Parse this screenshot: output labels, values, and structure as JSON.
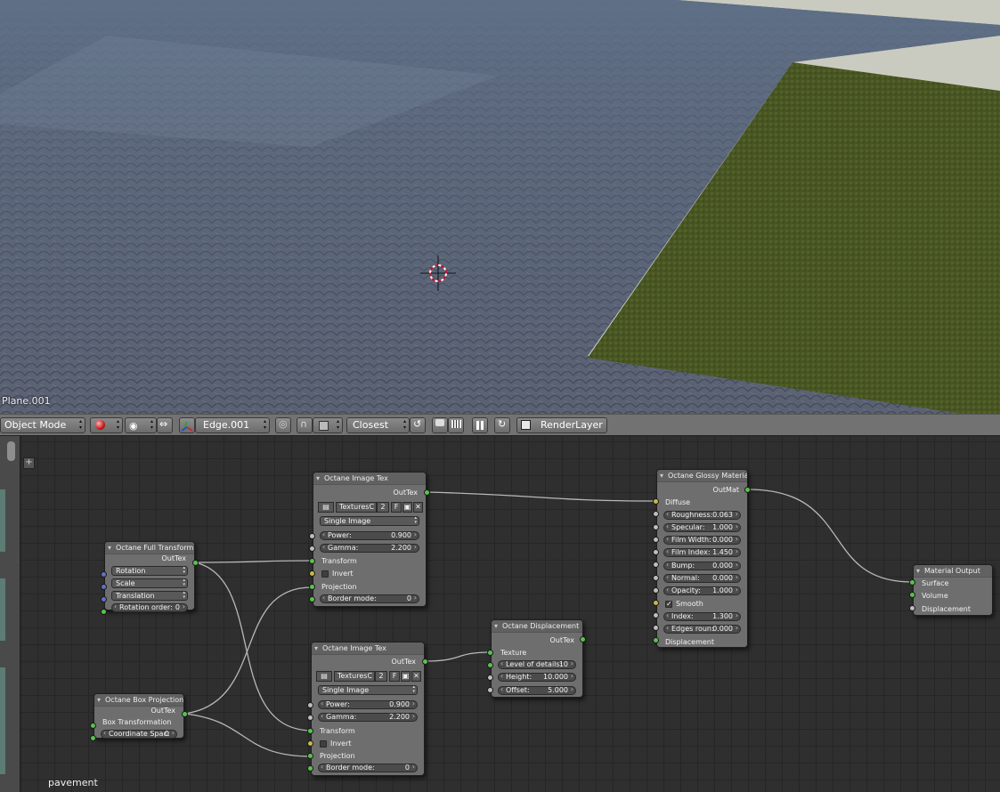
{
  "viewport": {
    "object_label": "Plane.001"
  },
  "header": {
    "mode": "Object Mode",
    "orientation": "Edge.001",
    "snap_element": "Closest",
    "render_layer": "RenderLayer"
  },
  "editor": {
    "material_name": "pavement",
    "add_button": "+"
  },
  "nodes": {
    "full_transform": {
      "title": "Octane Full Transform",
      "output": "OutTex",
      "rotation": "Rotation",
      "scale": "Scale",
      "translation": "Translation",
      "rotation_order_label": "Rotation order:",
      "rotation_order_value": "0"
    },
    "box_projection": {
      "title": "Octane Box Projection",
      "output": "OutTex",
      "box_transformation": "Box Transformation",
      "coordinate_label": "Coordinate Spac:",
      "coordinate_value": "0"
    },
    "image_tex_1": {
      "title": "Octane Image Tex",
      "output": "OutTex",
      "file": "TexturesC",
      "users": "2",
      "fake": "F",
      "mode": "Single Image",
      "power_label": "Power:",
      "power_value": "0.900",
      "gamma_label": "Gamma:",
      "gamma_value": "2.200",
      "transform": "Transform",
      "invert": "Invert",
      "projection": "Projection",
      "border_label": "Border mode:",
      "border_value": "0"
    },
    "image_tex_2": {
      "title": "Octane Image Tex",
      "output": "OutTex",
      "file": "TexturesC",
      "users": "2",
      "fake": "F",
      "mode": "Single Image",
      "power_label": "Power:",
      "power_value": "0.900",
      "gamma_label": "Gamma:",
      "gamma_value": "2.200",
      "transform": "Transform",
      "invert": "Invert",
      "projection": "Projection",
      "border_label": "Border mode:",
      "border_value": "0"
    },
    "displacement": {
      "title": "Octane Displacement",
      "output": "OutTex",
      "texture": "Texture",
      "lod_label": "Level of details:",
      "lod_value": "10",
      "height_label": "Height:",
      "height_value": "10.000",
      "offset_label": "Offset:",
      "offset_value": "5.000"
    },
    "glossy": {
      "title": "Octane Glossy Material",
      "output": "OutMat",
      "diffuse": "Diffuse",
      "roughness_label": "Roughness:",
      "roughness_value": "0.063",
      "specular_label": "Specular:",
      "specular_value": "1.000",
      "film_width_label": "Film Width:",
      "film_width_value": "0.000",
      "film_index_label": "Film Index:",
      "film_index_value": "1.450",
      "bump_label": "Bump:",
      "bump_value": "0.000",
      "normal_label": "Normal:",
      "normal_value": "0.000",
      "opacity_label": "Opacity:",
      "opacity_value": "1.000",
      "smooth": "Smooth",
      "index_label": "Index:",
      "index_value": "1.300",
      "edges_label": "Edges roun:",
      "edges_value": "0.000",
      "displacement": "Displacement"
    },
    "material_output": {
      "title": "Material Output",
      "surface": "Surface",
      "volume": "Volume",
      "displacement": "Displacement"
    }
  },
  "colors": {
    "socket_green": "#58c24d",
    "socket_yellow": "#c8b84a",
    "socket_gray": "#bdbdbd",
    "socket_blue": "#6370c0",
    "node_body": "#6e6e6e",
    "grid_bg": "#2f2f2f"
  }
}
